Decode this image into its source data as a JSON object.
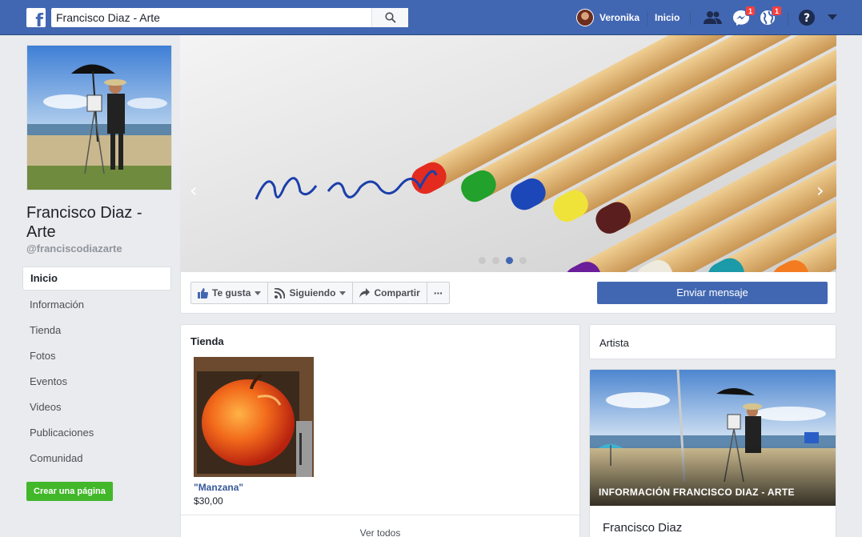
{
  "topbar": {
    "search_value": "Francisco Diaz - Arte",
    "user_name": "Veronika",
    "home_label": "Inicio",
    "messages_badge": "1",
    "notifications_badge": "1",
    "brand_color": "#4267b2"
  },
  "page": {
    "name": "Francisco Diaz - Arte",
    "handle": "@franciscodiazarte"
  },
  "nav": {
    "items": [
      "Inicio",
      "Información",
      "Tienda",
      "Fotos",
      "Eventos",
      "Videos",
      "Publicaciones",
      "Comunidad"
    ],
    "create_page": "Crear una página"
  },
  "cover": {
    "slides": 4,
    "active_slide": 3
  },
  "actions": {
    "like": "Te gusta",
    "following": "Siguiendo",
    "share": "Compartir",
    "more": "···",
    "send_message": "Enviar mensaje"
  },
  "shop": {
    "title": "Tienda",
    "product_name": "\"Manzana\"",
    "product_price": "$30,00",
    "see_all": "Ver todos"
  },
  "sidebar": {
    "category": "Artista",
    "info_caption": "INFORMACIÓN FRANCISCO DIAZ - ARTE",
    "info_name": "Francisco Diaz"
  }
}
